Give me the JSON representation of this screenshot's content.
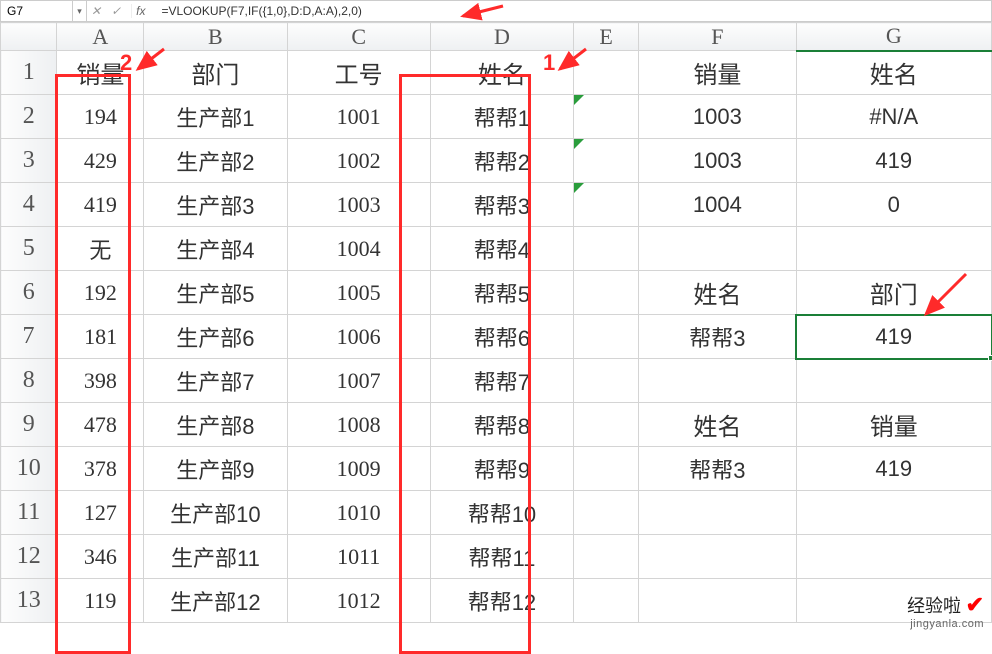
{
  "name_box": "G7",
  "formula": "=VLOOKUP(F7,IF({1,0},D:D,A:A),2,0)",
  "col_headers": [
    "A",
    "B",
    "C",
    "D",
    "E",
    "F",
    "G"
  ],
  "row_headers": [
    "1",
    "2",
    "3",
    "4",
    "5",
    "6",
    "7",
    "8",
    "9",
    "10",
    "11",
    "12",
    "13"
  ],
  "annotations": {
    "label1": "1",
    "label2": "2"
  },
  "table": {
    "header": {
      "A": "销量",
      "B": "部门",
      "C": "工号",
      "D": "姓名",
      "F": "销量",
      "G": "姓名"
    },
    "rows": [
      {
        "A": "194",
        "B": "生产部1",
        "C": "1001",
        "D": "帮帮1",
        "F": "1003",
        "G": "#N/A",
        "e_err": true
      },
      {
        "A": "429",
        "B": "生产部2",
        "C": "1002",
        "D": "帮帮2",
        "F": "1003",
        "G": "419",
        "g_big": true,
        "e_err": true
      },
      {
        "A": "419",
        "B": "生产部3",
        "C": "1003",
        "D": "帮帮3",
        "F": "1004",
        "G": "0",
        "g_big": true,
        "e_err": true
      },
      {
        "A": "无",
        "B": "生产部4",
        "C": "1004",
        "D": "帮帮4",
        "F": "",
        "G": ""
      },
      {
        "A": "192",
        "B": "生产部5",
        "C": "1005",
        "D": "帮帮5",
        "F": "姓名",
        "G": "部门",
        "fg_header": true
      },
      {
        "A": "181",
        "B": "生产部6",
        "C": "1006",
        "D": "帮帮6",
        "F": "帮帮3",
        "G": "419",
        "selected": true
      },
      {
        "A": "398",
        "B": "生产部7",
        "C": "1007",
        "D": "帮帮7",
        "F": "",
        "G": ""
      },
      {
        "A": "478",
        "B": "生产部8",
        "C": "1008",
        "D": "帮帮8",
        "F": "姓名",
        "G": "销量",
        "fg_header": true
      },
      {
        "A": "378",
        "B": "生产部9",
        "C": "1009",
        "D": "帮帮9",
        "F": "帮帮3",
        "G": "419"
      },
      {
        "A": "127",
        "B": "生产部10",
        "C": "1010",
        "D": "帮帮10",
        "F": "",
        "G": ""
      },
      {
        "A": "346",
        "B": "生产部11",
        "C": "1011",
        "D": "帮帮11",
        "F": "",
        "G": ""
      },
      {
        "A": "119",
        "B": "生产部12",
        "C": "1012",
        "D": "帮帮12",
        "F": "",
        "G": ""
      }
    ]
  },
  "watermark": {
    "text": "经验啦",
    "url": "jingyanla.com"
  }
}
